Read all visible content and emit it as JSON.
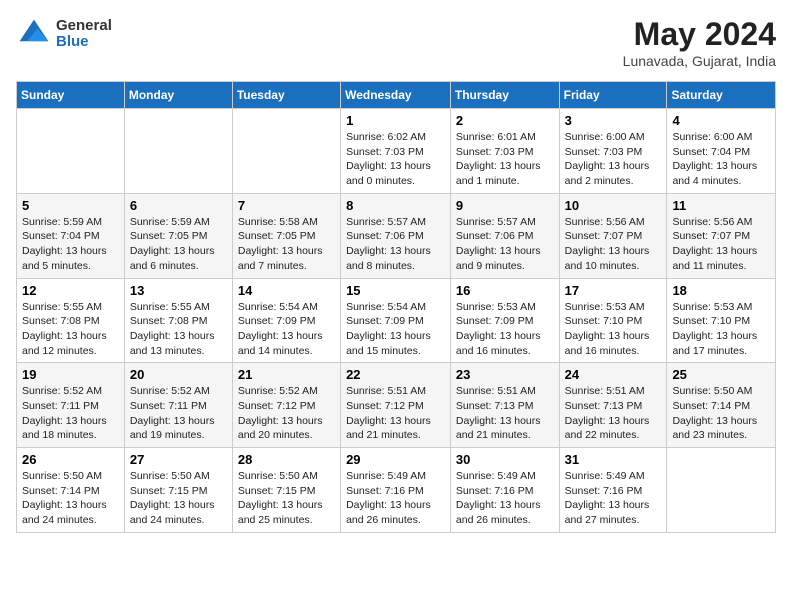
{
  "logo": {
    "general": "General",
    "blue": "Blue"
  },
  "title": "May 2024",
  "location": "Lunavada, Gujarat, India",
  "days_of_week": [
    "Sunday",
    "Monday",
    "Tuesday",
    "Wednesday",
    "Thursday",
    "Friday",
    "Saturday"
  ],
  "weeks": [
    [
      {
        "day": "",
        "info": ""
      },
      {
        "day": "",
        "info": ""
      },
      {
        "day": "",
        "info": ""
      },
      {
        "day": "1",
        "info": "Sunrise: 6:02 AM\nSunset: 7:03 PM\nDaylight: 13 hours\nand 0 minutes."
      },
      {
        "day": "2",
        "info": "Sunrise: 6:01 AM\nSunset: 7:03 PM\nDaylight: 13 hours\nand 1 minute."
      },
      {
        "day": "3",
        "info": "Sunrise: 6:00 AM\nSunset: 7:03 PM\nDaylight: 13 hours\nand 2 minutes."
      },
      {
        "day": "4",
        "info": "Sunrise: 6:00 AM\nSunset: 7:04 PM\nDaylight: 13 hours\nand 4 minutes."
      }
    ],
    [
      {
        "day": "5",
        "info": "Sunrise: 5:59 AM\nSunset: 7:04 PM\nDaylight: 13 hours\nand 5 minutes."
      },
      {
        "day": "6",
        "info": "Sunrise: 5:59 AM\nSunset: 7:05 PM\nDaylight: 13 hours\nand 6 minutes."
      },
      {
        "day": "7",
        "info": "Sunrise: 5:58 AM\nSunset: 7:05 PM\nDaylight: 13 hours\nand 7 minutes."
      },
      {
        "day": "8",
        "info": "Sunrise: 5:57 AM\nSunset: 7:06 PM\nDaylight: 13 hours\nand 8 minutes."
      },
      {
        "day": "9",
        "info": "Sunrise: 5:57 AM\nSunset: 7:06 PM\nDaylight: 13 hours\nand 9 minutes."
      },
      {
        "day": "10",
        "info": "Sunrise: 5:56 AM\nSunset: 7:07 PM\nDaylight: 13 hours\nand 10 minutes."
      },
      {
        "day": "11",
        "info": "Sunrise: 5:56 AM\nSunset: 7:07 PM\nDaylight: 13 hours\nand 11 minutes."
      }
    ],
    [
      {
        "day": "12",
        "info": "Sunrise: 5:55 AM\nSunset: 7:08 PM\nDaylight: 13 hours\nand 12 minutes."
      },
      {
        "day": "13",
        "info": "Sunrise: 5:55 AM\nSunset: 7:08 PM\nDaylight: 13 hours\nand 13 minutes."
      },
      {
        "day": "14",
        "info": "Sunrise: 5:54 AM\nSunset: 7:09 PM\nDaylight: 13 hours\nand 14 minutes."
      },
      {
        "day": "15",
        "info": "Sunrise: 5:54 AM\nSunset: 7:09 PM\nDaylight: 13 hours\nand 15 minutes."
      },
      {
        "day": "16",
        "info": "Sunrise: 5:53 AM\nSunset: 7:09 PM\nDaylight: 13 hours\nand 16 minutes."
      },
      {
        "day": "17",
        "info": "Sunrise: 5:53 AM\nSunset: 7:10 PM\nDaylight: 13 hours\nand 16 minutes."
      },
      {
        "day": "18",
        "info": "Sunrise: 5:53 AM\nSunset: 7:10 PM\nDaylight: 13 hours\nand 17 minutes."
      }
    ],
    [
      {
        "day": "19",
        "info": "Sunrise: 5:52 AM\nSunset: 7:11 PM\nDaylight: 13 hours\nand 18 minutes."
      },
      {
        "day": "20",
        "info": "Sunrise: 5:52 AM\nSunset: 7:11 PM\nDaylight: 13 hours\nand 19 minutes."
      },
      {
        "day": "21",
        "info": "Sunrise: 5:52 AM\nSunset: 7:12 PM\nDaylight: 13 hours\nand 20 minutes."
      },
      {
        "day": "22",
        "info": "Sunrise: 5:51 AM\nSunset: 7:12 PM\nDaylight: 13 hours\nand 21 minutes."
      },
      {
        "day": "23",
        "info": "Sunrise: 5:51 AM\nSunset: 7:13 PM\nDaylight: 13 hours\nand 21 minutes."
      },
      {
        "day": "24",
        "info": "Sunrise: 5:51 AM\nSunset: 7:13 PM\nDaylight: 13 hours\nand 22 minutes."
      },
      {
        "day": "25",
        "info": "Sunrise: 5:50 AM\nSunset: 7:14 PM\nDaylight: 13 hours\nand 23 minutes."
      }
    ],
    [
      {
        "day": "26",
        "info": "Sunrise: 5:50 AM\nSunset: 7:14 PM\nDaylight: 13 hours\nand 24 minutes."
      },
      {
        "day": "27",
        "info": "Sunrise: 5:50 AM\nSunset: 7:15 PM\nDaylight: 13 hours\nand 24 minutes."
      },
      {
        "day": "28",
        "info": "Sunrise: 5:50 AM\nSunset: 7:15 PM\nDaylight: 13 hours\nand 25 minutes."
      },
      {
        "day": "29",
        "info": "Sunrise: 5:49 AM\nSunset: 7:16 PM\nDaylight: 13 hours\nand 26 minutes."
      },
      {
        "day": "30",
        "info": "Sunrise: 5:49 AM\nSunset: 7:16 PM\nDaylight: 13 hours\nand 26 minutes."
      },
      {
        "day": "31",
        "info": "Sunrise: 5:49 AM\nSunset: 7:16 PM\nDaylight: 13 hours\nand 27 minutes."
      },
      {
        "day": "",
        "info": ""
      }
    ]
  ]
}
